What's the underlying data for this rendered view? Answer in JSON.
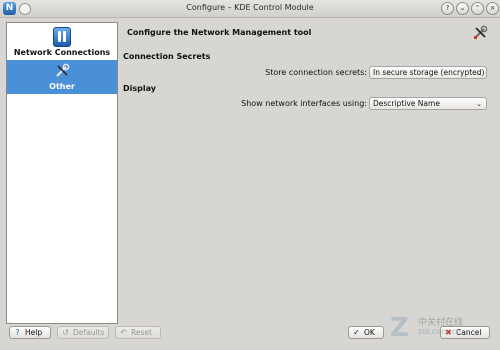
{
  "window": {
    "title": "Configure – KDE Control Module",
    "icon_letter": "N",
    "controls": [
      "help",
      "minimize",
      "maximize",
      "close"
    ]
  },
  "sidebar": {
    "items": [
      {
        "label": "Network Connections",
        "icon": "network-manager-icon",
        "selected": false
      },
      {
        "label": "Other",
        "icon": "tools-icon",
        "selected": true
      }
    ]
  },
  "main": {
    "title": "Configure the Network Management tool",
    "header_icon": "tools-icon",
    "sections": [
      {
        "heading": "Connection Secrets",
        "row_label": "Store connection secrets:",
        "select_value": "In secure storage (encrypted)"
      },
      {
        "heading": "Display",
        "row_label": "Show network interfaces using:",
        "select_value": "Descriptive Name"
      }
    ]
  },
  "footer": {
    "help": "Help",
    "defaults": "Defaults",
    "reset": "Reset",
    "ok": "OK",
    "cancel": "Cancel"
  },
  "watermark": {
    "brand": "Z",
    "text_cn": "中关村在线",
    "url": "zol.com.cn"
  },
  "colors": {
    "selection": "#4a90d9",
    "window_bg": "#d8d6d3"
  }
}
